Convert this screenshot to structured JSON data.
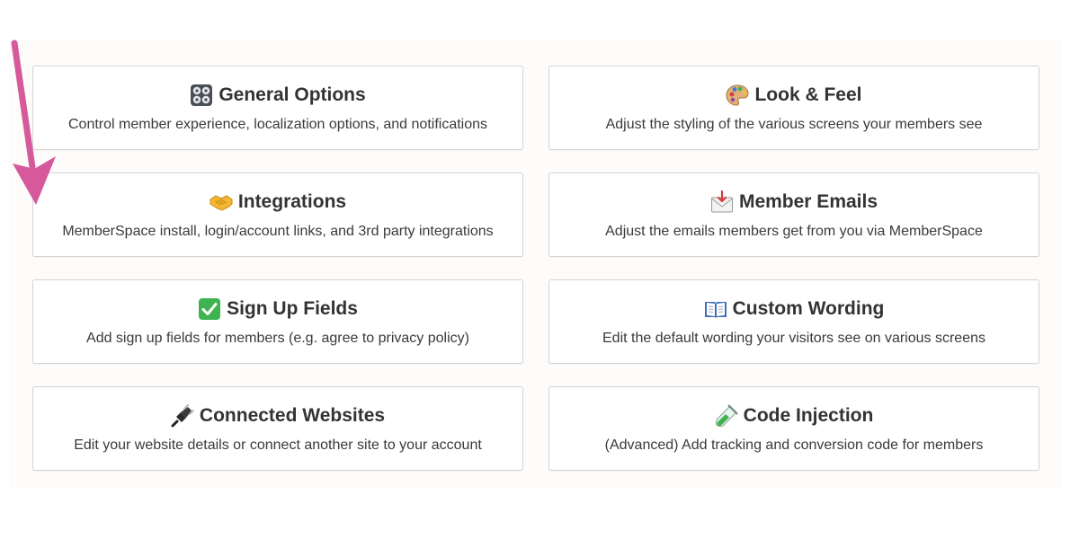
{
  "cards": [
    {
      "title": "General Options",
      "description": "Control member experience, localization options, and notifications",
      "icon": "control-knobs-icon"
    },
    {
      "title": "Look & Feel",
      "description": "Adjust the styling of the various screens your members see",
      "icon": "artist-palette-icon"
    },
    {
      "title": "Integrations",
      "description": "MemberSpace install, login/account links, and 3rd party integrations",
      "icon": "handshake-icon"
    },
    {
      "title": "Member Emails",
      "description": "Adjust the emails members get from you via MemberSpace",
      "icon": "envelope-arrow-icon"
    },
    {
      "title": "Sign Up Fields",
      "description": "Add sign up fields for members (e.g. agree to privacy policy)",
      "icon": "check-mark-button-icon"
    },
    {
      "title": "Custom Wording",
      "description": "Edit the default wording your visitors see on various screens",
      "icon": "open-book-icon"
    },
    {
      "title": "Connected Websites",
      "description": "Edit your website details or connect another site to your account",
      "icon": "electric-plug-icon"
    },
    {
      "title": "Code Injection",
      "description": "(Advanced) Add tracking and conversion code for members",
      "icon": "test-tube-icon"
    }
  ],
  "colors": {
    "arrow": "#d6599b",
    "card_border": "#d4d4d4",
    "check_green": "#3fb34f"
  }
}
